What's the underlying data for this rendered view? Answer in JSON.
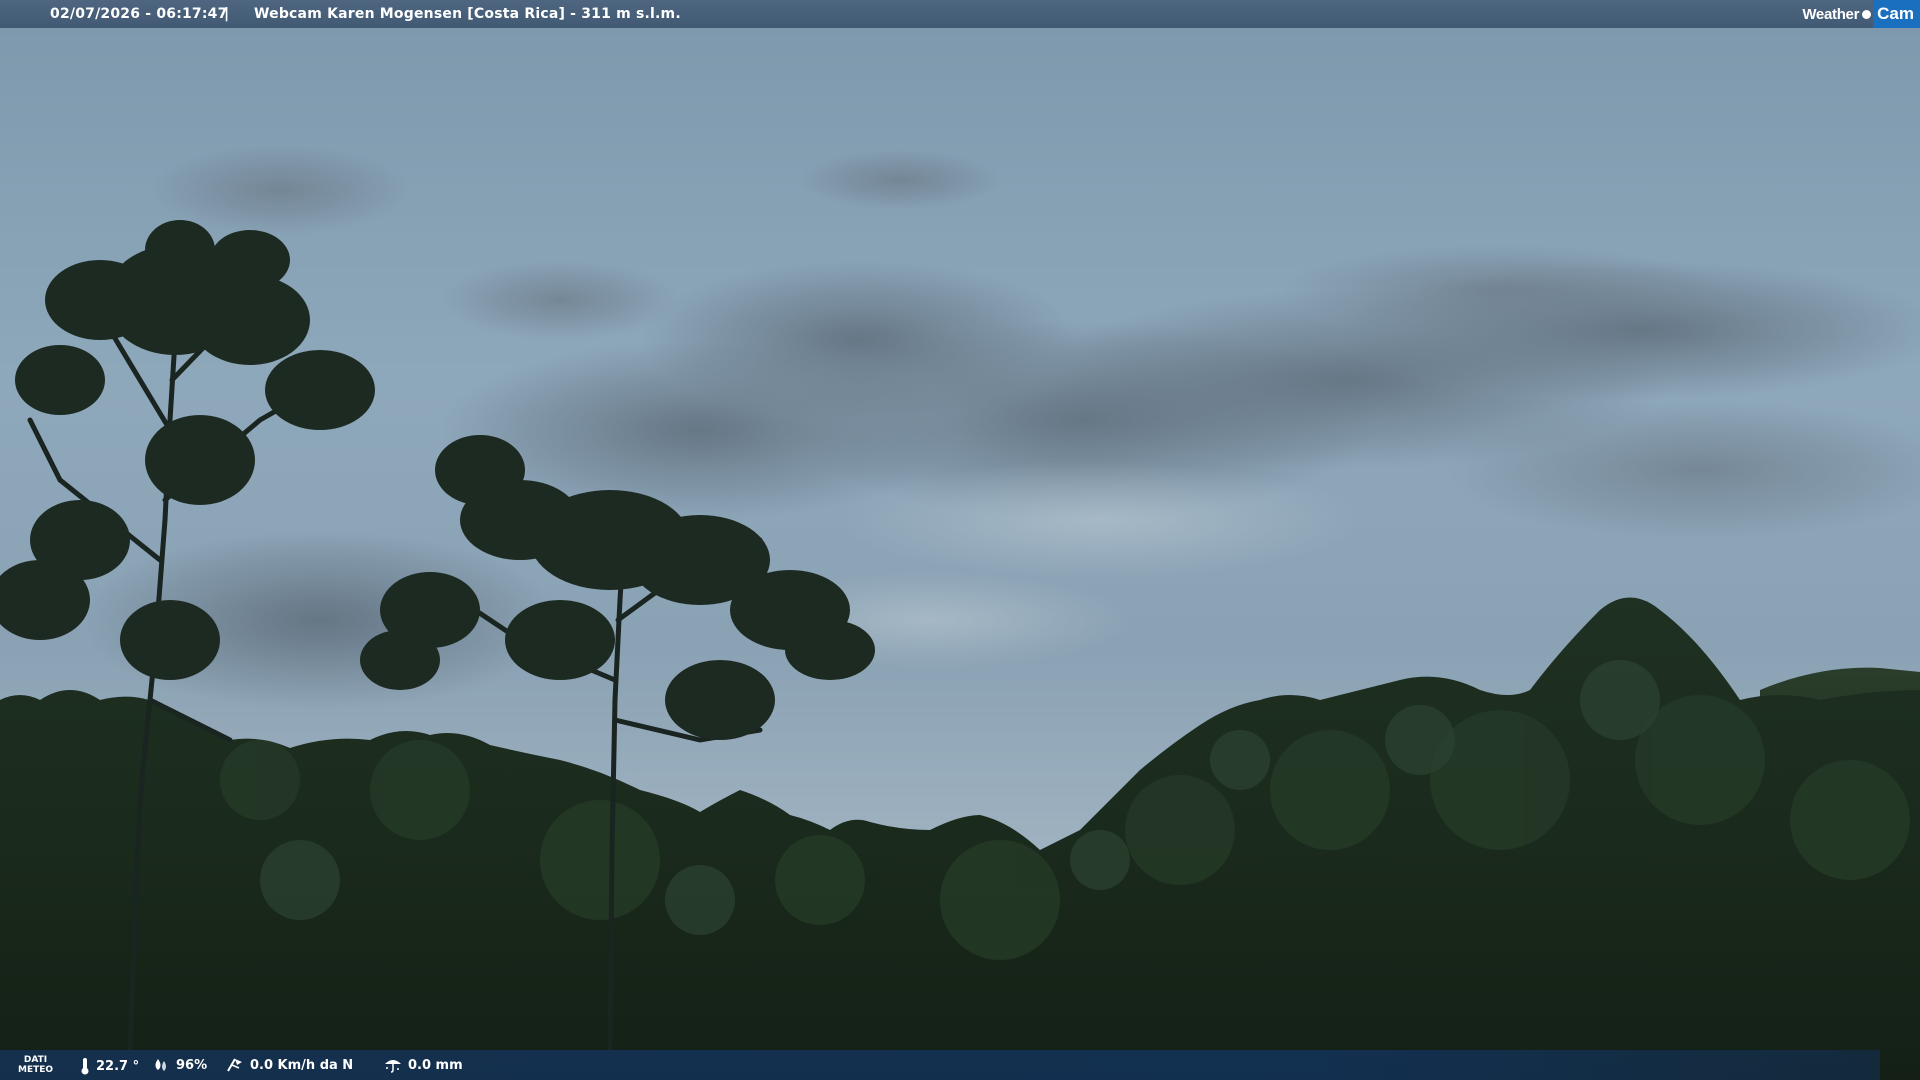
{
  "overlay": {
    "datetime": "02/07/2026 - 06:17:47",
    "separator": "|",
    "title": "Webcam Karen Mogensen [Costa Rica]  - 311 m s.l.m.",
    "logo_weather": "Weather",
    "logo_cam": "Cam"
  },
  "weather_bar": {
    "label_line1": "DATI",
    "label_line2": "METEO",
    "temperature": "22.7 °",
    "humidity": "96%",
    "wind": "0.0 Km/h da N",
    "rain": "0.0 mm",
    "icons": [
      "thermometer-icon",
      "humidity-icon",
      "wind-icon",
      "rain-icon"
    ]
  },
  "colors": {
    "bar_bg": "#3c546e",
    "logo_accent": "#1a6fbf"
  }
}
